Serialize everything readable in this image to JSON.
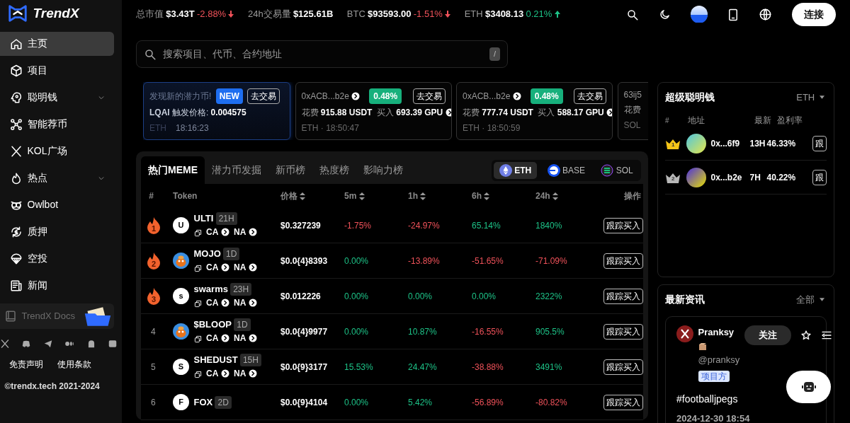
{
  "brand": {
    "name": "TrendX"
  },
  "ticker": [
    {
      "label": "总市值",
      "value": "$3.43T",
      "change": "-2.88%",
      "falling": true
    },
    {
      "label": "24h交易量",
      "value": "$125.61B"
    },
    {
      "label": "BTC",
      "value": "$93593.00",
      "change": "-1.51%",
      "falling": true
    },
    {
      "label": "ETH",
      "value": "$3408.13",
      "change": "0.21%",
      "falling": false
    }
  ],
  "connect_button": "连接",
  "sidebar": {
    "items": [
      {
        "label": "主页",
        "kind": "home",
        "selected": true,
        "expandable": false
      },
      {
        "label": "项目",
        "kind": "cube",
        "selected": false,
        "expandable": false
      },
      {
        "label": "聪明钱",
        "kind": "head",
        "selected": false,
        "expandable": true
      },
      {
        "label": "智能荐币",
        "kind": "nodes",
        "selected": false,
        "expandable": false
      },
      {
        "label": "KOL广场",
        "kind": "x",
        "selected": false,
        "expandable": false
      },
      {
        "label": "热点",
        "kind": "fire",
        "selected": false,
        "expandable": true
      },
      {
        "label": "Owlbot",
        "kind": "owl",
        "selected": false,
        "expandable": false
      },
      {
        "label": "质押",
        "kind": "stake",
        "selected": false,
        "expandable": false
      },
      {
        "label": "空投",
        "kind": "parachute",
        "selected": false,
        "expandable": false
      },
      {
        "label": "新闻",
        "kind": "news",
        "selected": false,
        "expandable": false
      }
    ],
    "docs": "TrendX Docs",
    "footer_links": [
      "免责声明",
      "使用条款"
    ],
    "copyright": "©trendx.tech 2021-2024"
  },
  "search": {
    "placeholder": "搜索项目、代币、合约地址",
    "shortcut": "/"
  },
  "alerts": [
    {
      "kind": "promo",
      "title": "发现新的潜力币!",
      "badge": "NEW",
      "action": "去交易",
      "symbol": "LQAI",
      "price_label": "触发价格:",
      "price": "0.004575",
      "chain": "ETH",
      "time": "18:16:23"
    },
    {
      "kind": "trade",
      "address": "0xACB...b2e",
      "change": "0.48%",
      "action": "去交易",
      "spend_label": "花费",
      "spend": "915.88 USDT",
      "buy_label": "买入",
      "buy": "693.39 GPU",
      "meta": "ETH · 18:50:47"
    },
    {
      "kind": "trade",
      "address": "0xACB...b2e",
      "change": "0.48%",
      "action": "去交易",
      "spend_label": "花费",
      "spend": "777.74 USDT",
      "buy_label": "买入",
      "buy": "588.17 GPU",
      "meta": "ETH · 18:50:59"
    },
    {
      "kind": "trade",
      "address": "63ij5",
      "spend_label": "花费",
      "meta": "SOL"
    }
  ],
  "tabs": [
    {
      "label": "热门MEME",
      "selected": true
    },
    {
      "label": "潜力币发掘",
      "selected": false
    },
    {
      "label": "新币榜",
      "selected": false
    },
    {
      "label": "热度榜",
      "selected": false
    },
    {
      "label": "影响力榜",
      "selected": false
    }
  ],
  "chains": [
    {
      "label": "ETH",
      "kind": "eth",
      "selected": true
    },
    {
      "label": "BASE",
      "kind": "base",
      "selected": false
    },
    {
      "label": "SOL",
      "kind": "sol",
      "selected": false
    }
  ],
  "table": {
    "columns": [
      {
        "label": "#",
        "sortable": false
      },
      {
        "label": "Token",
        "sortable": false
      },
      {
        "label": "价格",
        "sortable": true
      },
      {
        "label": "5m",
        "sortable": true
      },
      {
        "label": "1h",
        "sortable": true
      },
      {
        "label": "6h",
        "sortable": true
      },
      {
        "label": "24h",
        "sortable": true
      },
      {
        "label": "操作",
        "sortable": false
      }
    ],
    "rows": [
      {
        "rank": "1",
        "hot": true,
        "kind": "letter",
        "avatar": "U",
        "name": "ULTI",
        "age": "21H",
        "ca": "CA",
        "na": "NA",
        "price": "$0.327239",
        "changes": [
          {
            "value": "-1.75%",
            "falling": true
          },
          {
            "value": "-24.97%",
            "falling": true
          },
          {
            "value": "65.14%",
            "falling": false
          },
          {
            "value": "1840%",
            "falling": false
          }
        ],
        "action": "跟踪买入"
      },
      {
        "rank": "2",
        "hot": true,
        "kind": "picture",
        "name": "MOJO",
        "age": "1D",
        "ca": "CA",
        "na": "NA",
        "price": "$0.0{4}8393",
        "changes": [
          {
            "value": "0.00%",
            "falling": false
          },
          {
            "value": "-13.89%",
            "falling": true
          },
          {
            "value": "-51.65%",
            "falling": true
          },
          {
            "value": "-71.09%",
            "falling": true
          }
        ],
        "action": "跟踪买入"
      },
      {
        "rank": "3",
        "hot": true,
        "kind": "letter",
        "avatar": "s",
        "name": "swarms",
        "age": "23H",
        "ca": "CA",
        "na": "NA",
        "price": "$0.012226",
        "changes": [
          {
            "value": "0.00%",
            "falling": false
          },
          {
            "value": "0.00%",
            "falling": false
          },
          {
            "value": "0.00%",
            "falling": false
          },
          {
            "value": "2322%",
            "falling": false
          }
        ],
        "action": "跟踪买入"
      },
      {
        "rank": "4",
        "hot": false,
        "kind": "picture",
        "name": "$BLOOP",
        "age": "1D",
        "ca": "CA",
        "na": "NA",
        "price": "$0.0{4}9977",
        "changes": [
          {
            "value": "0.00%",
            "falling": false
          },
          {
            "value": "10.87%",
            "falling": false
          },
          {
            "value": "-16.55%",
            "falling": true
          },
          {
            "value": "905.5%",
            "falling": false
          }
        ],
        "action": "跟踪买入"
      },
      {
        "rank": "5",
        "hot": false,
        "kind": "letter",
        "avatar": "S",
        "name": "SHEDUST",
        "age": "15H",
        "ca": "CA",
        "na": "NA",
        "price": "$0.0{9}3177",
        "changes": [
          {
            "value": "15.53%",
            "falling": false
          },
          {
            "value": "24.47%",
            "falling": false
          },
          {
            "value": "-38.88%",
            "falling": true
          },
          {
            "value": "3491%",
            "falling": false
          }
        ],
        "action": "跟踪买入"
      },
      {
        "rank": "6",
        "hot": false,
        "kind": "letter",
        "avatar": "F",
        "name": "FOX",
        "age": "2D",
        "price": "$0.0{9}4104",
        "changes": [
          {
            "value": "0.00%",
            "falling": false
          },
          {
            "value": "5.42%",
            "falling": false
          },
          {
            "value": "-56.89%",
            "falling": true
          },
          {
            "value": "-80.82%",
            "falling": true
          }
        ],
        "action": "跟踪买入"
      }
    ]
  },
  "smart_money": {
    "title": "超级聪明钱",
    "filter": "ETH",
    "columns": [
      "#",
      "地址",
      "最新",
      "盈利率"
    ],
    "rows": [
      {
        "rank": "1",
        "color": "#f5c518",
        "address": "0x...6f9",
        "latest": "13H",
        "profit": "46.33%",
        "action": "跟"
      },
      {
        "rank": "2",
        "color": "#b8b8b8",
        "address": "0x...b2e",
        "latest": "7H",
        "profit": "40.22%",
        "action": "跟"
      }
    ]
  },
  "news": {
    "title": "最新资讯",
    "filter": "全部",
    "post": {
      "author": "Pranksy",
      "handle": "@pranksy",
      "tag": "项目方",
      "follow": "关注",
      "text": "#footballjpegs",
      "time": "2024-12-30 18:54"
    }
  }
}
